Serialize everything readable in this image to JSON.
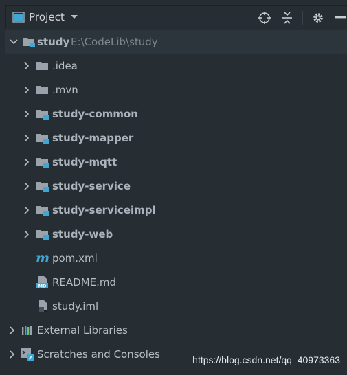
{
  "panel": {
    "title": "Project"
  },
  "tree": {
    "root": {
      "name": "study",
      "path": "E:\\CodeLib\\study"
    },
    "folders": [
      {
        "name": ".idea",
        "module": false
      },
      {
        "name": ".mvn",
        "module": false
      },
      {
        "name": "study-common",
        "module": true
      },
      {
        "name": "study-mapper",
        "module": true
      },
      {
        "name": "study-mqtt",
        "module": true
      },
      {
        "name": "study-service",
        "module": true
      },
      {
        "name": "study-serviceimpl",
        "module": true
      },
      {
        "name": "study-web",
        "module": true
      }
    ],
    "files": [
      {
        "name": "pom.xml",
        "icon": "maven-icon"
      },
      {
        "name": "README.md",
        "icon": "markdown-file-icon"
      },
      {
        "name": "study.iml",
        "icon": "iml-file-icon"
      }
    ],
    "external_libraries": "External Libraries",
    "scratches": "Scratches and Consoles"
  },
  "watermark": "https://blog.csdn.net/qq_40973363",
  "colors": {
    "background": "#262d33",
    "folder": "#9aa3ab",
    "module_badge": "#3fa7d6",
    "text": "#b8bec4"
  }
}
